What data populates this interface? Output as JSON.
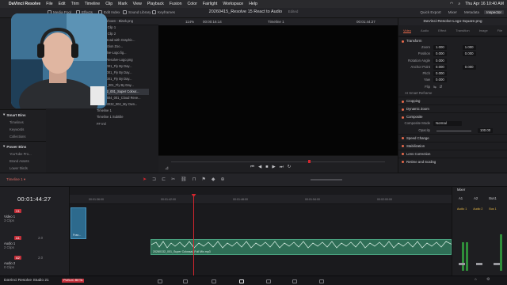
{
  "menubar": {
    "app": "DaVinci Resolve",
    "items": [
      "File",
      "Edit",
      "Trim",
      "Timeline",
      "Clip",
      "Mark",
      "View",
      "Playback",
      "Fusion",
      "Color",
      "Fairlight",
      "Workspace",
      "Help"
    ],
    "clock": "Thu Apr 16  10:40 AM"
  },
  "toolbar": {
    "left_items": [
      "Media Pool",
      "Effects",
      "Edit Index",
      "Sound Library",
      "Keyframes"
    ],
    "project_title": "20260415_Resolve 15 React to Audio",
    "edited": "Edited",
    "right_items": [
      "Quick Export",
      "Mixer",
      "Metadata",
      "Inspector"
    ],
    "active_right": "Inspector"
  },
  "media_pool": {
    "clips": [
      "...owershown - Blank.png",
      "...ound Clip 1",
      "...ound Clip 2",
      "...tom Head with Graphic...",
      "...Collection Zoo...",
      "...Resolve-Logo.fig...",
      "...olve-Resolve-Logo.png",
      "...161_001_Fly By Day...",
      "...161_001_Fly By Day...",
      "...161_001_Fly By Day...",
      "...0161_001_Fly By Day...",
      "...00132_001_Super Colour...",
      "...0060604_001_Cloud Reve...",
      "...20603032_002_My Own...",
      "Timeline 1",
      "Timeline 1 Subtitle",
      "FF Intl"
    ],
    "selected_index": 11,
    "smart_bins": {
      "title": "Smart Bins",
      "items": [
        "Timelines",
        "Keywords",
        "Collections"
      ]
    },
    "power_bins": {
      "title": "Power Bins",
      "items": [
        "YouTube Pro...",
        "Brand Assets",
        "Lower thirds"
      ]
    }
  },
  "viewer": {
    "zoom": "114%",
    "timecode_in": "00:00:16:14",
    "timeline_name": "Timeline 1",
    "timecode": "00:01:44:27"
  },
  "inspector": {
    "filename": "DaVinci-Resolve-Logo-Square.png",
    "tabs": [
      "Video",
      "Audio",
      "Effect",
      "Transition",
      "Image",
      "File"
    ],
    "active_tab": "Video",
    "sections_top": [
      "Transform"
    ],
    "transform_rows": [
      {
        "label": "Zoom",
        "x": "1.000",
        "y": "1.000"
      },
      {
        "label": "Position",
        "x": "0.000",
        "y": "0.000"
      },
      {
        "label": "Rotation Angle",
        "x": "0.000",
        "y": ""
      },
      {
        "label": "Anchor Point",
        "x": "0.000",
        "y": "0.000"
      },
      {
        "label": "Pitch",
        "x": "0.000",
        "y": ""
      },
      {
        "label": "Yaw",
        "x": "0.000",
        "y": ""
      },
      {
        "label": "Flip",
        "x": "",
        "y": ""
      }
    ],
    "smart_reframe": "AI Smart Reframe",
    "sections_mid": [
      "Cropping",
      "Dynamic Zoom",
      "Composite"
    ],
    "composite_mode_label": "Composite Mode",
    "composite_mode": "Normal",
    "opacity_label": "Opacity",
    "opacity": "100.00",
    "sections_bottom": [
      "Speed Change",
      "Stabilization",
      "Lens Correction",
      "Retime and Scaling"
    ]
  },
  "timeline": {
    "name": "Timeline 1",
    "timecode": "00:01:44:27",
    "ruler_labels": [
      "00:01:36:00",
      "00:01:42:00",
      "00:01:48:00",
      "00:01:54:00",
      "00:02:00:00"
    ],
    "tracks": [
      {
        "id": "V1",
        "name": "Video 1",
        "clips_label": "3 Clips"
      },
      {
        "id": "A1",
        "name": "Audio 1",
        "clips_label": "2 Clips",
        "level": "2.0"
      },
      {
        "id": "A2",
        "name": "Audio 2",
        "clips_label": "0 Clips",
        "level": "2.0"
      }
    ],
    "video_clip_label": "Fran...",
    "audio_clip_label": "20260132_001_Super Colossal_Full Mix.mp3"
  },
  "mixer": {
    "title": "Mixer",
    "channels": [
      "A1",
      "A2",
      "Bus1"
    ],
    "channel_names": [
      "Audio 1",
      "Audio 2",
      "Bus 1"
    ]
  },
  "pagebar": {
    "app_label": "DaVinci Resolve Studio 21",
    "badge": "PUBLIC BETA",
    "pages": [
      "Cut",
      "Edit",
      "Fusion",
      "Color",
      "Fairlight",
      "Deliver"
    ],
    "active_page": "Edit"
  },
  "colors": {
    "accent": "#e86a4b",
    "playhead": "#d3262e",
    "audio_clip": "#2f6e56",
    "video_clip": "#2d6a8d"
  }
}
